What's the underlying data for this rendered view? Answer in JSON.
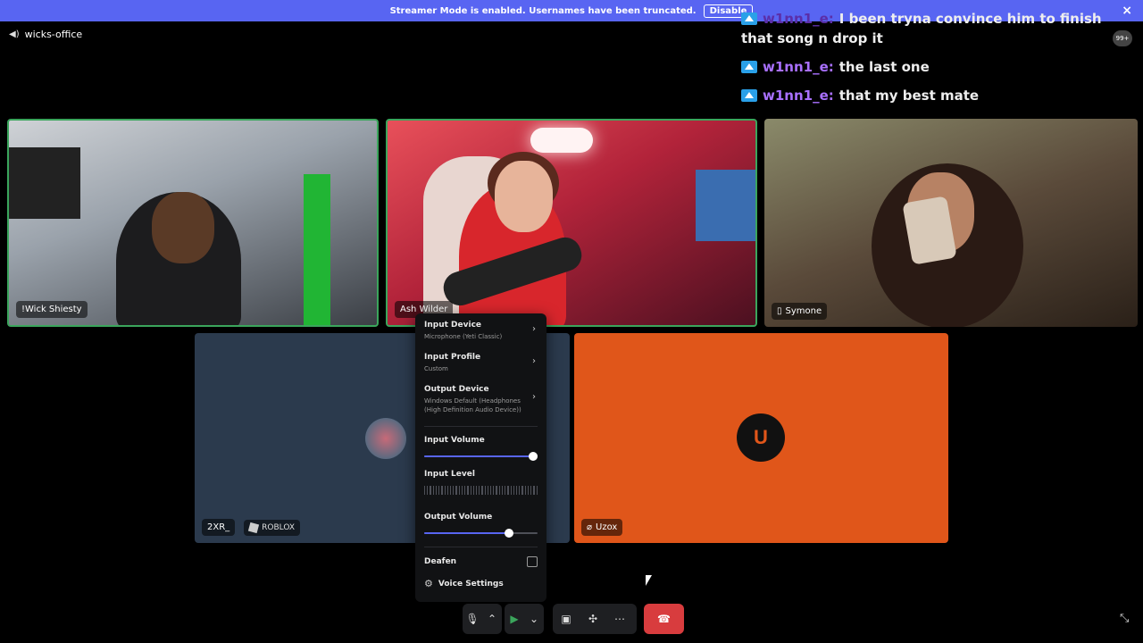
{
  "banner": {
    "text": "Streamer Mode is enabled. Usernames have been truncated.",
    "disable_label": "Disable",
    "close_icon": "×"
  },
  "channel": {
    "name": "wicks-office"
  },
  "notification": {
    "count": "99+"
  },
  "chat": [
    {
      "user": "w1nn1_e:",
      "text": "I been tryna convince him to finish that song n drop it"
    },
    {
      "user": "w1nn1_e:",
      "text": "the last one"
    },
    {
      "user": "w1nn1_e:",
      "text": "that my best mate"
    }
  ],
  "tiles": {
    "t1": {
      "name": "!Wick Shiesty"
    },
    "t2": {
      "name": "Ash Wilder"
    },
    "t3": {
      "name": "Symone"
    },
    "t4": {
      "name": "2XR_",
      "activity": "ROBLOX"
    },
    "t5": {
      "name": "Uzox"
    }
  },
  "menu": {
    "input_device": {
      "label": "Input Device",
      "value": "Microphone (Yeti Classic)"
    },
    "input_profile": {
      "label": "Input Profile",
      "value": "Custom"
    },
    "output_device": {
      "label": "Output Device",
      "value": "Windows Default (Headphones (High Definition Audio Device))"
    },
    "input_volume": {
      "label": "Input Volume",
      "level": 0.96
    },
    "input_level": {
      "label": "Input Level"
    },
    "output_volume": {
      "label": "Output Volume",
      "level": 0.75
    },
    "deafen": {
      "label": "Deafen",
      "checked": false
    },
    "voice_settings": {
      "label": "Voice Settings"
    }
  },
  "colors": {
    "accent": "#5865f2",
    "speaking": "#3ba55c",
    "hangup": "#d83c3e",
    "uzox_bg": "#e0561a"
  }
}
